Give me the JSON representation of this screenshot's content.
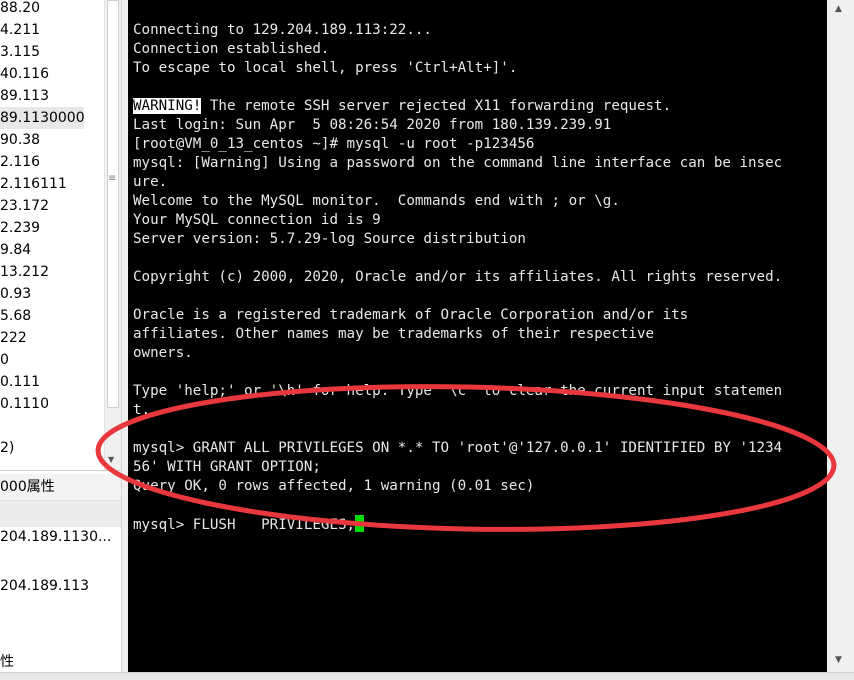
{
  "sessions": {
    "items": [
      {
        "label": "88.20",
        "selected": false
      },
      {
        "label": "4.211",
        "selected": false
      },
      {
        "label": "3.115",
        "selected": false
      },
      {
        "label": "40.116",
        "selected": false
      },
      {
        "label": "89.113",
        "selected": false
      },
      {
        "label": "89.1130000",
        "selected": true
      },
      {
        "label": "90.38",
        "selected": false
      },
      {
        "label": "2.116",
        "selected": false
      },
      {
        "label": "2.116111",
        "selected": false
      },
      {
        "label": "23.172",
        "selected": false
      },
      {
        "label": "2.239",
        "selected": false
      },
      {
        "label": "9.84",
        "selected": false
      },
      {
        "label": "13.212",
        "selected": false
      },
      {
        "label": "0.93",
        "selected": false
      },
      {
        "label": "5.68",
        "selected": false
      },
      {
        "label": "222",
        "selected": false
      },
      {
        "label": "0",
        "selected": false
      },
      {
        "label": "0.111",
        "selected": false
      },
      {
        "label": "0.1110",
        "selected": false
      },
      {
        "label": "",
        "selected": false
      },
      {
        "label": "2)",
        "selected": false
      }
    ]
  },
  "properties": {
    "header": "000属性",
    "row1": "204.189.1130...",
    "row2": "204.189.113",
    "row3": "性"
  },
  "terminal": {
    "lines": [
      "Connecting to 129.204.189.113:22...",
      "Connection established.",
      "To escape to local shell, press 'Ctrl+Alt+]'.",
      "",
      "",
      "Last login: Sun Apr  5 08:26:54 2020 from 180.139.239.91",
      "[root@VM_0_13_centos ~]# mysql -u root -p123456",
      "mysql: [Warning] Using a password on the command line interface can be insec",
      "ure.",
      "Welcome to the MySQL monitor.  Commands end with ; or \\g.",
      "Your MySQL connection id is 9",
      "Server version: 5.7.29-log Source distribution",
      "",
      "Copyright (c) 2000, 2020, Oracle and/or its affiliates. All rights reserved.",
      "",
      "Oracle is a registered trademark of Oracle Corporation and/or its",
      "affiliates. Other names may be trademarks of their respective",
      "owners.",
      "",
      "Type 'help;' or '\\h' for help. Type '\\c' to clear the current input statemen",
      "t.",
      "",
      "mysql> GRANT ALL PRIVILEGES ON *.* TO 'root'@'127.0.0.1' IDENTIFIED BY '1234",
      "56' WITH GRANT OPTION;",
      "Query OK, 0 rows affected, 1 warning (0.01 sec)",
      "",
      "mysql> FLUSH   PRIVILEGES;"
    ],
    "warning_badge": "WARNING!",
    "warning_rest": " The remote SSH server rejected X11 forwarding request.",
    "cursor_color": "#00dd00",
    "background": "#000000",
    "foreground": "#e8e8e8"
  },
  "annotation": {
    "shape": "ellipse",
    "color": "#e8383d"
  }
}
